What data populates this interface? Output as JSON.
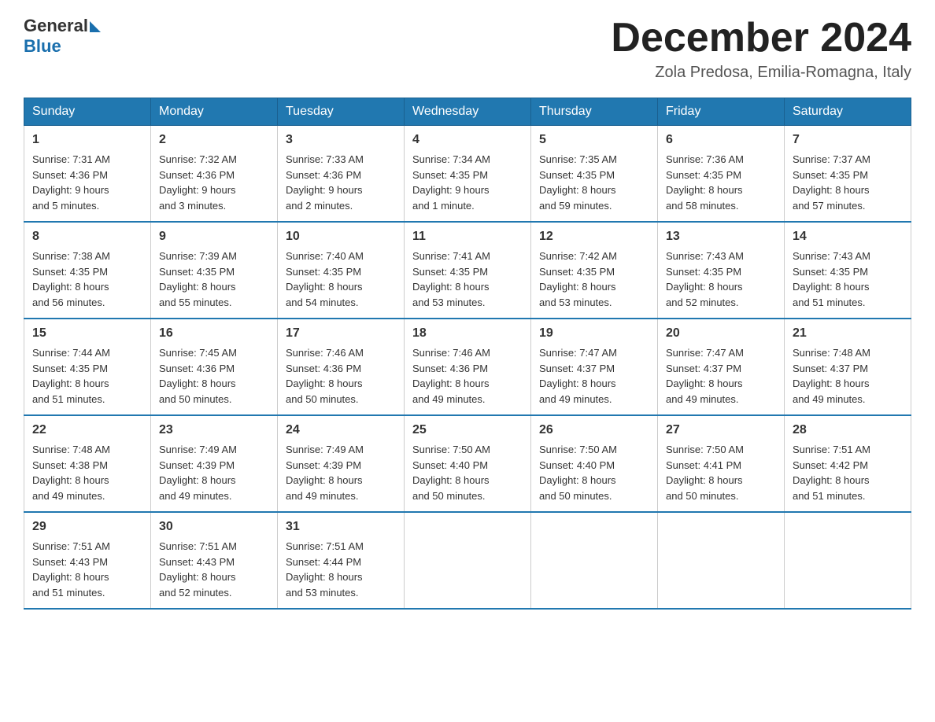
{
  "header": {
    "logo_text_general": "General",
    "logo_text_blue": "Blue",
    "month_title": "December 2024",
    "location": "Zola Predosa, Emilia-Romagna, Italy"
  },
  "days_of_week": [
    "Sunday",
    "Monday",
    "Tuesday",
    "Wednesday",
    "Thursday",
    "Friday",
    "Saturday"
  ],
  "weeks": [
    [
      {
        "day": "1",
        "sunrise": "7:31 AM",
        "sunset": "4:36 PM",
        "daylight": "9 hours and 5 minutes."
      },
      {
        "day": "2",
        "sunrise": "7:32 AM",
        "sunset": "4:36 PM",
        "daylight": "9 hours and 3 minutes."
      },
      {
        "day": "3",
        "sunrise": "7:33 AM",
        "sunset": "4:36 PM",
        "daylight": "9 hours and 2 minutes."
      },
      {
        "day": "4",
        "sunrise": "7:34 AM",
        "sunset": "4:35 PM",
        "daylight": "9 hours and 1 minute."
      },
      {
        "day": "5",
        "sunrise": "7:35 AM",
        "sunset": "4:35 PM",
        "daylight": "8 hours and 59 minutes."
      },
      {
        "day": "6",
        "sunrise": "7:36 AM",
        "sunset": "4:35 PM",
        "daylight": "8 hours and 58 minutes."
      },
      {
        "day": "7",
        "sunrise": "7:37 AM",
        "sunset": "4:35 PM",
        "daylight": "8 hours and 57 minutes."
      }
    ],
    [
      {
        "day": "8",
        "sunrise": "7:38 AM",
        "sunset": "4:35 PM",
        "daylight": "8 hours and 56 minutes."
      },
      {
        "day": "9",
        "sunrise": "7:39 AM",
        "sunset": "4:35 PM",
        "daylight": "8 hours and 55 minutes."
      },
      {
        "day": "10",
        "sunrise": "7:40 AM",
        "sunset": "4:35 PM",
        "daylight": "8 hours and 54 minutes."
      },
      {
        "day": "11",
        "sunrise": "7:41 AM",
        "sunset": "4:35 PM",
        "daylight": "8 hours and 53 minutes."
      },
      {
        "day": "12",
        "sunrise": "7:42 AM",
        "sunset": "4:35 PM",
        "daylight": "8 hours and 53 minutes."
      },
      {
        "day": "13",
        "sunrise": "7:43 AM",
        "sunset": "4:35 PM",
        "daylight": "8 hours and 52 minutes."
      },
      {
        "day": "14",
        "sunrise": "7:43 AM",
        "sunset": "4:35 PM",
        "daylight": "8 hours and 51 minutes."
      }
    ],
    [
      {
        "day": "15",
        "sunrise": "7:44 AM",
        "sunset": "4:35 PM",
        "daylight": "8 hours and 51 minutes."
      },
      {
        "day": "16",
        "sunrise": "7:45 AM",
        "sunset": "4:36 PM",
        "daylight": "8 hours and 50 minutes."
      },
      {
        "day": "17",
        "sunrise": "7:46 AM",
        "sunset": "4:36 PM",
        "daylight": "8 hours and 50 minutes."
      },
      {
        "day": "18",
        "sunrise": "7:46 AM",
        "sunset": "4:36 PM",
        "daylight": "8 hours and 49 minutes."
      },
      {
        "day": "19",
        "sunrise": "7:47 AM",
        "sunset": "4:37 PM",
        "daylight": "8 hours and 49 minutes."
      },
      {
        "day": "20",
        "sunrise": "7:47 AM",
        "sunset": "4:37 PM",
        "daylight": "8 hours and 49 minutes."
      },
      {
        "day": "21",
        "sunrise": "7:48 AM",
        "sunset": "4:37 PM",
        "daylight": "8 hours and 49 minutes."
      }
    ],
    [
      {
        "day": "22",
        "sunrise": "7:48 AM",
        "sunset": "4:38 PM",
        "daylight": "8 hours and 49 minutes."
      },
      {
        "day": "23",
        "sunrise": "7:49 AM",
        "sunset": "4:39 PM",
        "daylight": "8 hours and 49 minutes."
      },
      {
        "day": "24",
        "sunrise": "7:49 AM",
        "sunset": "4:39 PM",
        "daylight": "8 hours and 49 minutes."
      },
      {
        "day": "25",
        "sunrise": "7:50 AM",
        "sunset": "4:40 PM",
        "daylight": "8 hours and 50 minutes."
      },
      {
        "day": "26",
        "sunrise": "7:50 AM",
        "sunset": "4:40 PM",
        "daylight": "8 hours and 50 minutes."
      },
      {
        "day": "27",
        "sunrise": "7:50 AM",
        "sunset": "4:41 PM",
        "daylight": "8 hours and 50 minutes."
      },
      {
        "day": "28",
        "sunrise": "7:51 AM",
        "sunset": "4:42 PM",
        "daylight": "8 hours and 51 minutes."
      }
    ],
    [
      {
        "day": "29",
        "sunrise": "7:51 AM",
        "sunset": "4:43 PM",
        "daylight": "8 hours and 51 minutes."
      },
      {
        "day": "30",
        "sunrise": "7:51 AM",
        "sunset": "4:43 PM",
        "daylight": "8 hours and 52 minutes."
      },
      {
        "day": "31",
        "sunrise": "7:51 AM",
        "sunset": "4:44 PM",
        "daylight": "8 hours and 53 minutes."
      },
      null,
      null,
      null,
      null
    ]
  ]
}
